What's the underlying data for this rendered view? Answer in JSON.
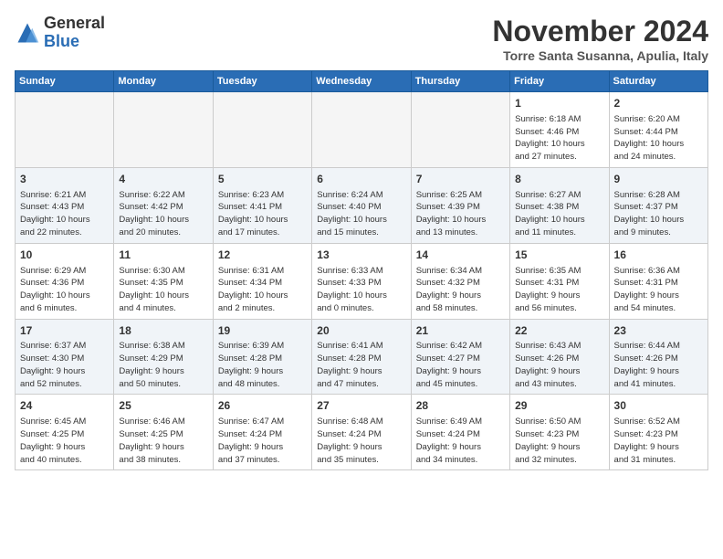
{
  "header": {
    "logo_line1": "General",
    "logo_line2": "Blue",
    "month": "November 2024",
    "location": "Torre Santa Susanna, Apulia, Italy"
  },
  "weekdays": [
    "Sunday",
    "Monday",
    "Tuesday",
    "Wednesday",
    "Thursday",
    "Friday",
    "Saturday"
  ],
  "weeks": [
    [
      {
        "day": "",
        "info": ""
      },
      {
        "day": "",
        "info": ""
      },
      {
        "day": "",
        "info": ""
      },
      {
        "day": "",
        "info": ""
      },
      {
        "day": "",
        "info": ""
      },
      {
        "day": "1",
        "info": "Sunrise: 6:18 AM\nSunset: 4:46 PM\nDaylight: 10 hours\nand 27 minutes."
      },
      {
        "day": "2",
        "info": "Sunrise: 6:20 AM\nSunset: 4:44 PM\nDaylight: 10 hours\nand 24 minutes."
      }
    ],
    [
      {
        "day": "3",
        "info": "Sunrise: 6:21 AM\nSunset: 4:43 PM\nDaylight: 10 hours\nand 22 minutes."
      },
      {
        "day": "4",
        "info": "Sunrise: 6:22 AM\nSunset: 4:42 PM\nDaylight: 10 hours\nand 20 minutes."
      },
      {
        "day": "5",
        "info": "Sunrise: 6:23 AM\nSunset: 4:41 PM\nDaylight: 10 hours\nand 17 minutes."
      },
      {
        "day": "6",
        "info": "Sunrise: 6:24 AM\nSunset: 4:40 PM\nDaylight: 10 hours\nand 15 minutes."
      },
      {
        "day": "7",
        "info": "Sunrise: 6:25 AM\nSunset: 4:39 PM\nDaylight: 10 hours\nand 13 minutes."
      },
      {
        "day": "8",
        "info": "Sunrise: 6:27 AM\nSunset: 4:38 PM\nDaylight: 10 hours\nand 11 minutes."
      },
      {
        "day": "9",
        "info": "Sunrise: 6:28 AM\nSunset: 4:37 PM\nDaylight: 10 hours\nand 9 minutes."
      }
    ],
    [
      {
        "day": "10",
        "info": "Sunrise: 6:29 AM\nSunset: 4:36 PM\nDaylight: 10 hours\nand 6 minutes."
      },
      {
        "day": "11",
        "info": "Sunrise: 6:30 AM\nSunset: 4:35 PM\nDaylight: 10 hours\nand 4 minutes."
      },
      {
        "day": "12",
        "info": "Sunrise: 6:31 AM\nSunset: 4:34 PM\nDaylight: 10 hours\nand 2 minutes."
      },
      {
        "day": "13",
        "info": "Sunrise: 6:33 AM\nSunset: 4:33 PM\nDaylight: 10 hours\nand 0 minutes."
      },
      {
        "day": "14",
        "info": "Sunrise: 6:34 AM\nSunset: 4:32 PM\nDaylight: 9 hours\nand 58 minutes."
      },
      {
        "day": "15",
        "info": "Sunrise: 6:35 AM\nSunset: 4:31 PM\nDaylight: 9 hours\nand 56 minutes."
      },
      {
        "day": "16",
        "info": "Sunrise: 6:36 AM\nSunset: 4:31 PM\nDaylight: 9 hours\nand 54 minutes."
      }
    ],
    [
      {
        "day": "17",
        "info": "Sunrise: 6:37 AM\nSunset: 4:30 PM\nDaylight: 9 hours\nand 52 minutes."
      },
      {
        "day": "18",
        "info": "Sunrise: 6:38 AM\nSunset: 4:29 PM\nDaylight: 9 hours\nand 50 minutes."
      },
      {
        "day": "19",
        "info": "Sunrise: 6:39 AM\nSunset: 4:28 PM\nDaylight: 9 hours\nand 48 minutes."
      },
      {
        "day": "20",
        "info": "Sunrise: 6:41 AM\nSunset: 4:28 PM\nDaylight: 9 hours\nand 47 minutes."
      },
      {
        "day": "21",
        "info": "Sunrise: 6:42 AM\nSunset: 4:27 PM\nDaylight: 9 hours\nand 45 minutes."
      },
      {
        "day": "22",
        "info": "Sunrise: 6:43 AM\nSunset: 4:26 PM\nDaylight: 9 hours\nand 43 minutes."
      },
      {
        "day": "23",
        "info": "Sunrise: 6:44 AM\nSunset: 4:26 PM\nDaylight: 9 hours\nand 41 minutes."
      }
    ],
    [
      {
        "day": "24",
        "info": "Sunrise: 6:45 AM\nSunset: 4:25 PM\nDaylight: 9 hours\nand 40 minutes."
      },
      {
        "day": "25",
        "info": "Sunrise: 6:46 AM\nSunset: 4:25 PM\nDaylight: 9 hours\nand 38 minutes."
      },
      {
        "day": "26",
        "info": "Sunrise: 6:47 AM\nSunset: 4:24 PM\nDaylight: 9 hours\nand 37 minutes."
      },
      {
        "day": "27",
        "info": "Sunrise: 6:48 AM\nSunset: 4:24 PM\nDaylight: 9 hours\nand 35 minutes."
      },
      {
        "day": "28",
        "info": "Sunrise: 6:49 AM\nSunset: 4:24 PM\nDaylight: 9 hours\nand 34 minutes."
      },
      {
        "day": "29",
        "info": "Sunrise: 6:50 AM\nSunset: 4:23 PM\nDaylight: 9 hours\nand 32 minutes."
      },
      {
        "day": "30",
        "info": "Sunrise: 6:52 AM\nSunset: 4:23 PM\nDaylight: 9 hours\nand 31 minutes."
      }
    ]
  ]
}
